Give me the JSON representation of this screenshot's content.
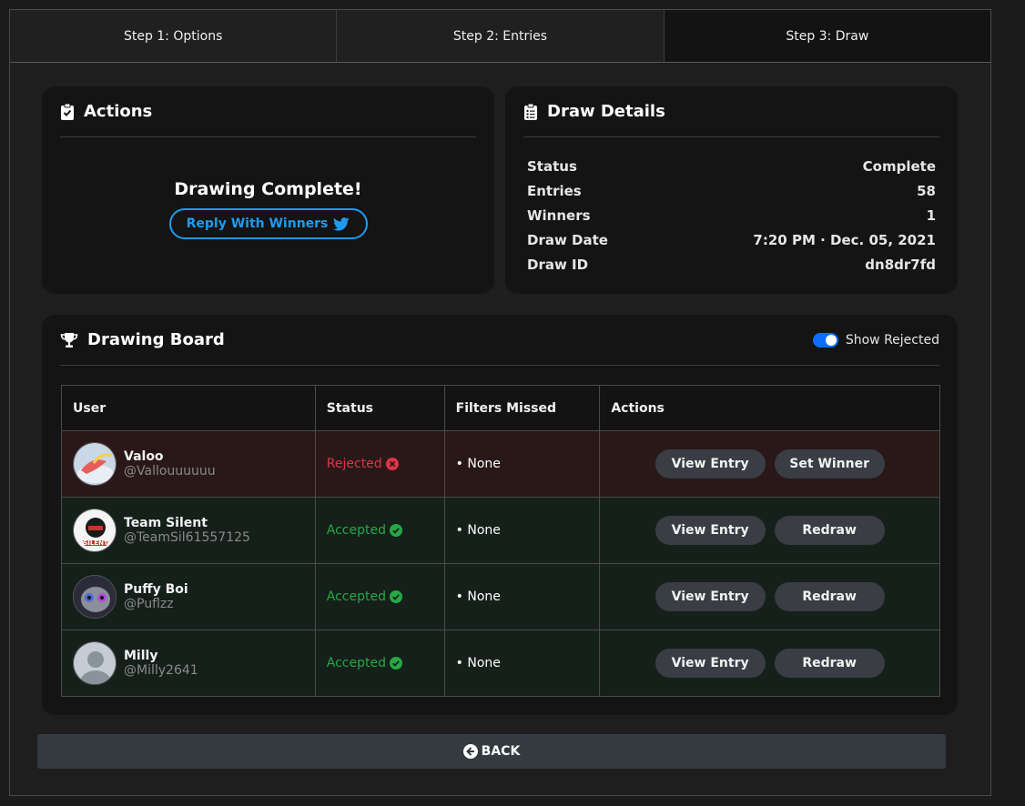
{
  "tabs": [
    "Step 1: Options",
    "Step 2: Entries",
    "Step 3: Draw"
  ],
  "actions_card": {
    "title": "Actions",
    "complete_text": "Drawing Complete!",
    "reply_label": "Reply With Winners"
  },
  "details_card": {
    "title": "Draw Details",
    "rows": [
      {
        "label": "Status",
        "value": "Complete"
      },
      {
        "label": "Entries",
        "value": "58"
      },
      {
        "label": "Winners",
        "value": "1"
      },
      {
        "label": "Draw Date",
        "value": "7:20 PM · Dec. 05, 2021"
      },
      {
        "label": "Draw ID",
        "value": "dn8dr7fd"
      }
    ]
  },
  "board": {
    "title": "Drawing Board",
    "toggle_label": "Show Rejected",
    "toggle_on": true,
    "columns": [
      "User",
      "Status",
      "Filters Missed",
      "Actions"
    ],
    "rows": [
      {
        "name": "Valoo",
        "handle": "@Vallouuuuuu",
        "status": "Rejected",
        "filters": "• None",
        "action1": "View Entry",
        "action2": "Set Winner"
      },
      {
        "name": "Team Silent",
        "handle": "@TeamSil61557125",
        "status": "Accepted",
        "filters": "• None",
        "action1": "View Entry",
        "action2": "Redraw"
      },
      {
        "name": "Puffy Boi",
        "handle": "@Puflzz",
        "status": "Accepted",
        "filters": "• None",
        "action1": "View Entry",
        "action2": "Redraw"
      },
      {
        "name": "Milly",
        "handle": "@Milly2641",
        "status": "Accepted",
        "filters": "• None",
        "action1": "View Entry",
        "action2": "Redraw"
      }
    ]
  },
  "back_label": "BACK",
  "colors": {
    "accent_blue": "#1d9bf0",
    "rejected": "#dc3545",
    "accepted": "#28a745",
    "toggle": "#0d6efd"
  },
  "icons": [
    "clipboard-check-icon",
    "clipboard-list-icon",
    "trophy-icon",
    "twitter-icon",
    "times-circle-icon",
    "check-circle-icon",
    "arrow-circle-left-icon"
  ]
}
